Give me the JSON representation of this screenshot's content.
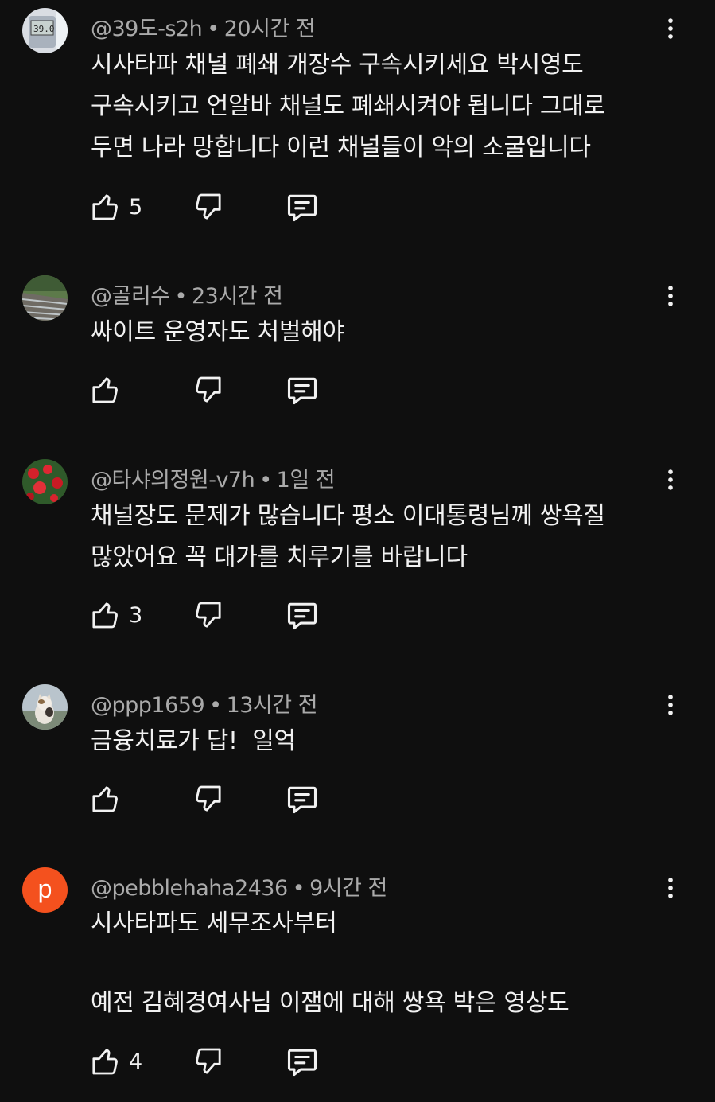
{
  "comments": [
    {
      "author": "@39도-s2h",
      "time": "20시간 전",
      "text": "시사타파 채널 폐쇄 개장수 구속시키세요 박시영도\n구속시키고 언알바 채널도 폐쇄시켜야 됩니다 그대로\n두면 나라 망합니다 이런 채널들이 악의 소굴입니다",
      "likes": "5",
      "avatar_label": "39.0"
    },
    {
      "author": "@골리수",
      "time": "23시간 전",
      "text": "싸이트 운영자도 처벌해야",
      "likes": ""
    },
    {
      "author": "@타샤의정원-v7h",
      "time": "1일 전",
      "text": "채널장도 문제가 많습니다 평소 이대통령님께 쌍욕질\n많았어요 꼭 대가를 치루기를 바랍니다",
      "likes": "3"
    },
    {
      "author": "@ppp1659",
      "time": "13시간 전",
      "text": "금융치료가 답!  일억",
      "likes": ""
    },
    {
      "author": "@pebblehaha2436",
      "time": "9시간 전",
      "text": "시사타파도 세무조사부터\n\n예전 김혜경여사님 이잼에 대해 쌍욕 박은 영상도",
      "likes": "4",
      "avatar_letter": "p"
    }
  ],
  "separator": "•",
  "icons": {
    "like": "thumbs-up-icon",
    "dislike": "thumbs-down-icon",
    "reply": "reply-icon",
    "more": "more-vert-icon"
  },
  "colors": {
    "background": "#0f0f0f",
    "text": "#f1f1f1",
    "meta": "#aaaaaa",
    "avatar_p": "#f4511e"
  }
}
